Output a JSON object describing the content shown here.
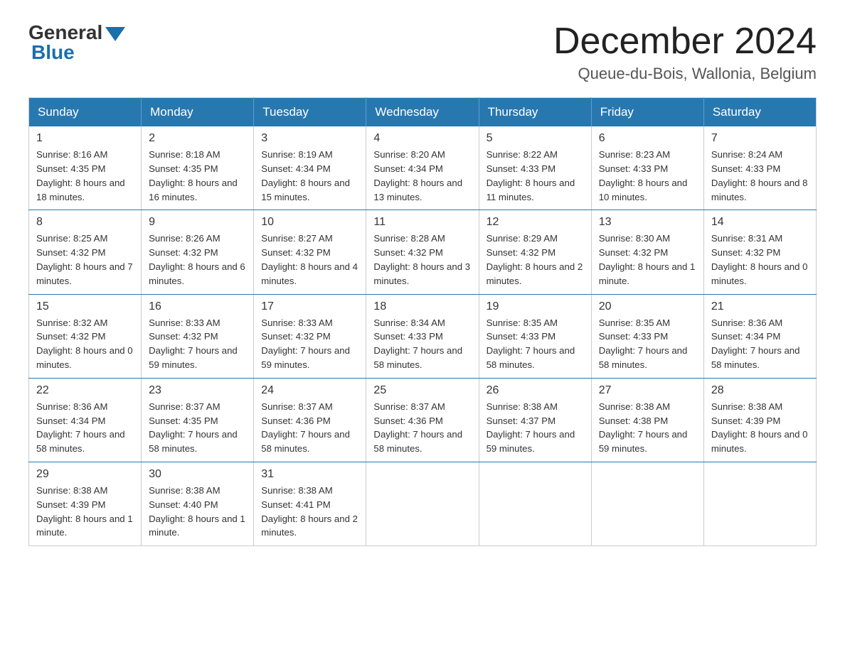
{
  "header": {
    "logo_general": "General",
    "logo_blue": "Blue",
    "main_title": "December 2024",
    "subtitle": "Queue-du-Bois, Wallonia, Belgium"
  },
  "weekdays": [
    "Sunday",
    "Monday",
    "Tuesday",
    "Wednesday",
    "Thursday",
    "Friday",
    "Saturday"
  ],
  "weeks": [
    [
      {
        "day": "1",
        "sunrise": "8:16 AM",
        "sunset": "4:35 PM",
        "daylight": "8 hours and 18 minutes."
      },
      {
        "day": "2",
        "sunrise": "8:18 AM",
        "sunset": "4:35 PM",
        "daylight": "8 hours and 16 minutes."
      },
      {
        "day": "3",
        "sunrise": "8:19 AM",
        "sunset": "4:34 PM",
        "daylight": "8 hours and 15 minutes."
      },
      {
        "day": "4",
        "sunrise": "8:20 AM",
        "sunset": "4:34 PM",
        "daylight": "8 hours and 13 minutes."
      },
      {
        "day": "5",
        "sunrise": "8:22 AM",
        "sunset": "4:33 PM",
        "daylight": "8 hours and 11 minutes."
      },
      {
        "day": "6",
        "sunrise": "8:23 AM",
        "sunset": "4:33 PM",
        "daylight": "8 hours and 10 minutes."
      },
      {
        "day": "7",
        "sunrise": "8:24 AM",
        "sunset": "4:33 PM",
        "daylight": "8 hours and 8 minutes."
      }
    ],
    [
      {
        "day": "8",
        "sunrise": "8:25 AM",
        "sunset": "4:32 PM",
        "daylight": "8 hours and 7 minutes."
      },
      {
        "day": "9",
        "sunrise": "8:26 AM",
        "sunset": "4:32 PM",
        "daylight": "8 hours and 6 minutes."
      },
      {
        "day": "10",
        "sunrise": "8:27 AM",
        "sunset": "4:32 PM",
        "daylight": "8 hours and 4 minutes."
      },
      {
        "day": "11",
        "sunrise": "8:28 AM",
        "sunset": "4:32 PM",
        "daylight": "8 hours and 3 minutes."
      },
      {
        "day": "12",
        "sunrise": "8:29 AM",
        "sunset": "4:32 PM",
        "daylight": "8 hours and 2 minutes."
      },
      {
        "day": "13",
        "sunrise": "8:30 AM",
        "sunset": "4:32 PM",
        "daylight": "8 hours and 1 minute."
      },
      {
        "day": "14",
        "sunrise": "8:31 AM",
        "sunset": "4:32 PM",
        "daylight": "8 hours and 0 minutes."
      }
    ],
    [
      {
        "day": "15",
        "sunrise": "8:32 AM",
        "sunset": "4:32 PM",
        "daylight": "8 hours and 0 minutes."
      },
      {
        "day": "16",
        "sunrise": "8:33 AM",
        "sunset": "4:32 PM",
        "daylight": "7 hours and 59 minutes."
      },
      {
        "day": "17",
        "sunrise": "8:33 AM",
        "sunset": "4:32 PM",
        "daylight": "7 hours and 59 minutes."
      },
      {
        "day": "18",
        "sunrise": "8:34 AM",
        "sunset": "4:33 PM",
        "daylight": "7 hours and 58 minutes."
      },
      {
        "day": "19",
        "sunrise": "8:35 AM",
        "sunset": "4:33 PM",
        "daylight": "7 hours and 58 minutes."
      },
      {
        "day": "20",
        "sunrise": "8:35 AM",
        "sunset": "4:33 PM",
        "daylight": "7 hours and 58 minutes."
      },
      {
        "day": "21",
        "sunrise": "8:36 AM",
        "sunset": "4:34 PM",
        "daylight": "7 hours and 58 minutes."
      }
    ],
    [
      {
        "day": "22",
        "sunrise": "8:36 AM",
        "sunset": "4:34 PM",
        "daylight": "7 hours and 58 minutes."
      },
      {
        "day": "23",
        "sunrise": "8:37 AM",
        "sunset": "4:35 PM",
        "daylight": "7 hours and 58 minutes."
      },
      {
        "day": "24",
        "sunrise": "8:37 AM",
        "sunset": "4:36 PM",
        "daylight": "7 hours and 58 minutes."
      },
      {
        "day": "25",
        "sunrise": "8:37 AM",
        "sunset": "4:36 PM",
        "daylight": "7 hours and 58 minutes."
      },
      {
        "day": "26",
        "sunrise": "8:38 AM",
        "sunset": "4:37 PM",
        "daylight": "7 hours and 59 minutes."
      },
      {
        "day": "27",
        "sunrise": "8:38 AM",
        "sunset": "4:38 PM",
        "daylight": "7 hours and 59 minutes."
      },
      {
        "day": "28",
        "sunrise": "8:38 AM",
        "sunset": "4:39 PM",
        "daylight": "8 hours and 0 minutes."
      }
    ],
    [
      {
        "day": "29",
        "sunrise": "8:38 AM",
        "sunset": "4:39 PM",
        "daylight": "8 hours and 1 minute."
      },
      {
        "day": "30",
        "sunrise": "8:38 AM",
        "sunset": "4:40 PM",
        "daylight": "8 hours and 1 minute."
      },
      {
        "day": "31",
        "sunrise": "8:38 AM",
        "sunset": "4:41 PM",
        "daylight": "8 hours and 2 minutes."
      },
      null,
      null,
      null,
      null
    ]
  ],
  "labels": {
    "sunrise": "Sunrise:",
    "sunset": "Sunset:",
    "daylight": "Daylight:"
  }
}
